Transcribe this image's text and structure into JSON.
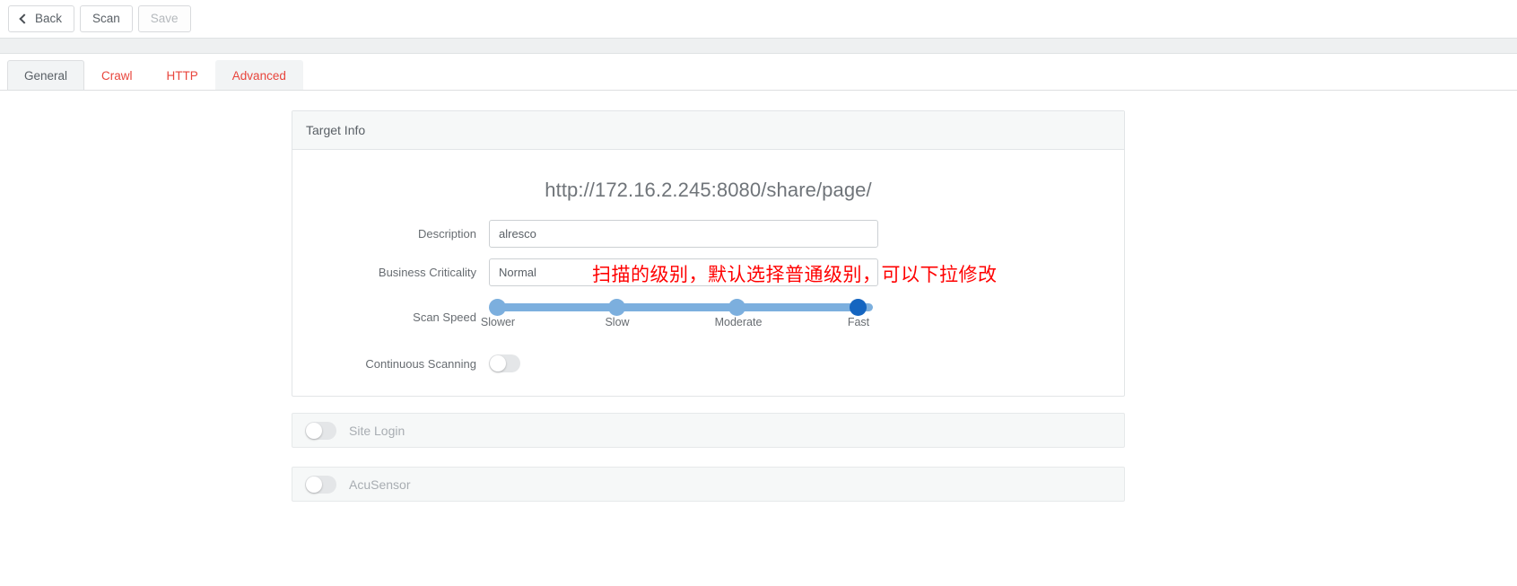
{
  "toolbar": {
    "back_label": "Back",
    "scan_label": "Scan",
    "save_label": "Save"
  },
  "tabs": [
    {
      "label": "General",
      "state": "active"
    },
    {
      "label": "Crawl",
      "state": "link"
    },
    {
      "label": "HTTP",
      "state": "link"
    },
    {
      "label": "Advanced",
      "state": "highlight"
    }
  ],
  "target_panel": {
    "title": "Target Info",
    "url": "http://172.16.2.245:8080/share/page/",
    "description": {
      "label": "Description",
      "value": "alresco",
      "placeholder": ""
    },
    "business_criticality": {
      "label": "Business Criticality",
      "value": "Normal",
      "options": [
        "Normal"
      ]
    },
    "scan_speed": {
      "label": "Scan Speed",
      "ticks": [
        "Slower",
        "Slow",
        "Moderate",
        "Fast"
      ],
      "selected": "Fast",
      "selected_index": 3
    },
    "continuous_scanning": {
      "label": "Continuous Scanning",
      "value": "off"
    }
  },
  "collapsed_panels": [
    {
      "title": "Site Login",
      "toggle": "off"
    },
    {
      "title": "AcuSensor",
      "toggle": "off"
    }
  ],
  "annotations": [
    {
      "text": "扫描的级别，默认选择普通级别，可以下拉修改",
      "color": "#ff0000"
    }
  ],
  "colors": {
    "accent_red": "#e8453c",
    "slider_blue": "#7cafde",
    "slider_selected_blue": "#1565c0",
    "annotation_red": "#ff0000"
  }
}
